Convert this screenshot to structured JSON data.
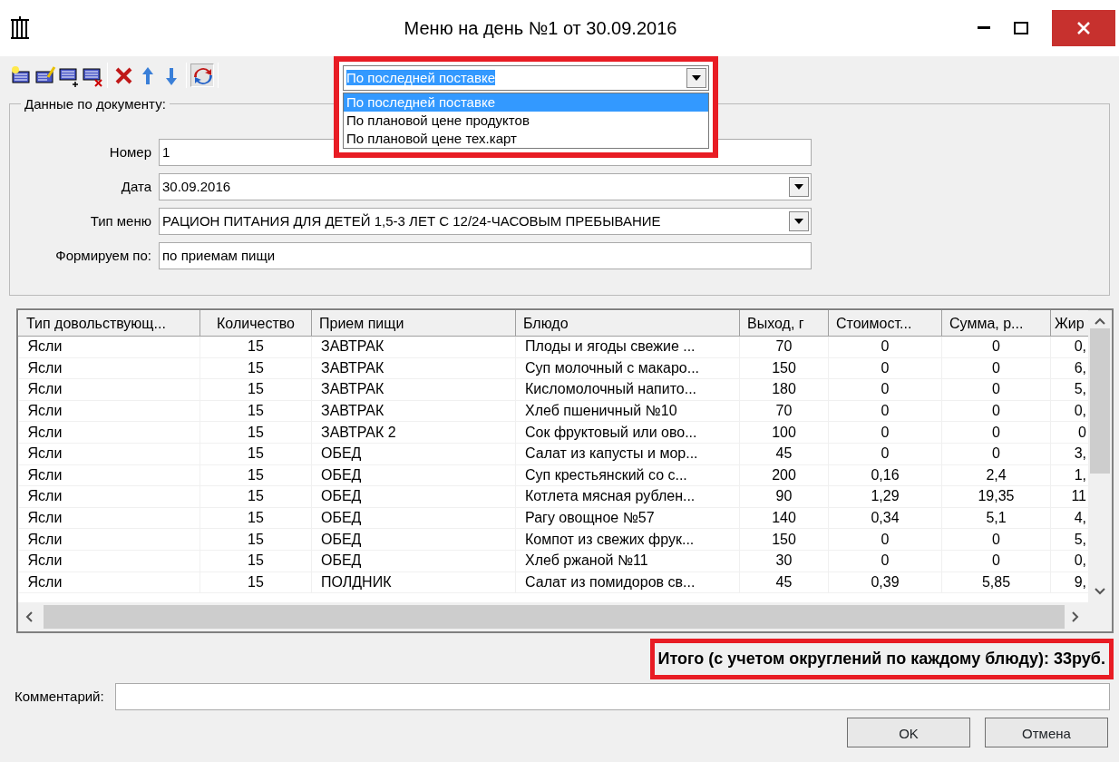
{
  "window": {
    "title": "Меню на день №1 от 30.09.2016"
  },
  "price_source": {
    "value": "По последней поставке",
    "options": [
      {
        "label": "По последней поставке",
        "selected": true
      },
      {
        "label": "По плановой цене продуктов",
        "selected": false
      },
      {
        "label": "По плановой цене тех.карт",
        "selected": false
      }
    ]
  },
  "document_group": {
    "title": "Данные по документу:",
    "fields": [
      {
        "label": "Номер",
        "value": "1",
        "kind": "text"
      },
      {
        "label": "Дата",
        "value": "30.09.2016",
        "kind": "combo"
      },
      {
        "label": "Тип меню",
        "value": "РАЦИОН ПИТАНИЯ ДЛЯ ДЕТЕЙ 1,5-3 ЛЕТ С 12/24-ЧАСОВЫМ ПРЕБЫВАНИЕ",
        "kind": "combo"
      },
      {
        "label": "Формируем по:",
        "value": "по приемам пищи",
        "kind": "text"
      }
    ]
  },
  "table": {
    "columns": [
      "Тип довольствующ...",
      "Количество",
      "Прием пищи",
      "Блюдо",
      "Выход, г",
      "Стоимост...",
      "Сумма, р...",
      "Жир"
    ],
    "rows": [
      [
        "Ясли",
        "15",
        "ЗАВТРАК",
        "Плоды и ягоды свежие ...",
        "70",
        "0",
        "0",
        "0,"
      ],
      [
        "Ясли",
        "15",
        "ЗАВТРАК",
        "Суп молочный с макаро...",
        "150",
        "0",
        "0",
        "6,"
      ],
      [
        "Ясли",
        "15",
        "ЗАВТРАК",
        "Кисломолочный напито...",
        "180",
        "0",
        "0",
        "5,"
      ],
      [
        "Ясли",
        "15",
        "ЗАВТРАК",
        "Хлеб пшеничный №10",
        "70",
        "0",
        "0",
        "0,"
      ],
      [
        "Ясли",
        "15",
        "ЗАВТРАК 2",
        "Сок фруктовый или ово...",
        "100",
        "0",
        "0",
        "0"
      ],
      [
        "Ясли",
        "15",
        "ОБЕД",
        "Салат из капусты и мор...",
        "45",
        "0",
        "0",
        "3,"
      ],
      [
        "Ясли",
        "15",
        "ОБЕД",
        "Суп крестьянский со с...",
        "200",
        "0,16",
        "2,4",
        "1,"
      ],
      [
        "Ясли",
        "15",
        "ОБЕД",
        "Котлета мясная рублен...",
        "90",
        "1,29",
        "19,35",
        "11"
      ],
      [
        "Ясли",
        "15",
        "ОБЕД",
        "Рагу овощное №57",
        "140",
        "0,34",
        "5,1",
        "4,"
      ],
      [
        "Ясли",
        "15",
        "ОБЕД",
        "Компот из свежих фрук...",
        "150",
        "0",
        "0",
        "5,"
      ],
      [
        "Ясли",
        "15",
        "ОБЕД",
        "Хлеб ржаной №11",
        "30",
        "0",
        "0",
        "0,"
      ],
      [
        "Ясли",
        "15",
        "ПОЛДНИК",
        "Салат из помидоров св...",
        "45",
        "0,39",
        "5,85",
        "9,"
      ]
    ]
  },
  "total": "Итого (с учетом округлений по каждому блюду): 33руб.",
  "comment": {
    "label": "Комментарий:"
  },
  "buttons": [
    "OK",
    "Отмена"
  ]
}
